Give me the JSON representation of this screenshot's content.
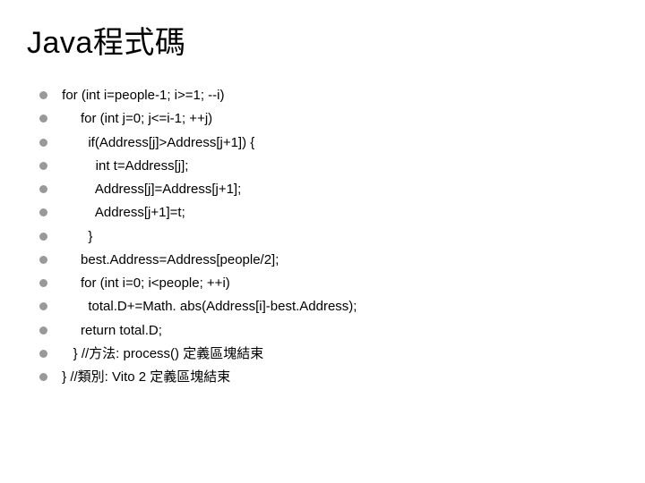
{
  "title": "Java程式碼",
  "lines": [
    " for (int i=people-1; i>=1; --i)",
    "      for (int j=0; j<=i-1; ++j)",
    "        if(Address[j]>Address[j+1]) {",
    "          int t=Address[j];",
    "          Address[j]=Address[j+1];",
    "          Address[j+1]=t;",
    "        }",
    "      best.Address=Address[people/2];",
    "      for (int i=0; i<people; ++i)",
    "        total.D+=Math. abs(Address[i]-best.Address);",
    "      return total.D;",
    "    } //方法: process() 定義區塊結束",
    " } //類別: Vito 2 定義區塊結束"
  ]
}
